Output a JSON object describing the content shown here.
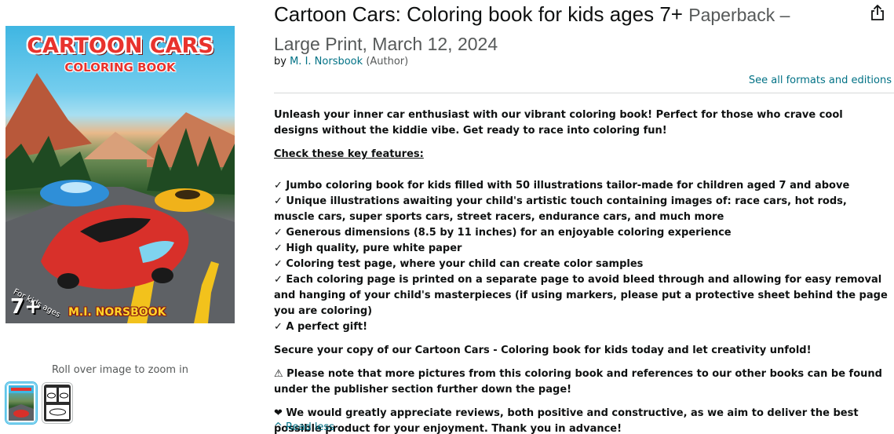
{
  "product": {
    "title": "Cartoon Cars: Coloring book for kids ages 7+",
    "format_date_line1": "Paperback –",
    "format_date_line2": "Large Print, March 12, 2024",
    "by_prefix": "by",
    "author": "M. I. Norsbook",
    "author_role": "(Author)",
    "see_all_formats": "See all formats and editions"
  },
  "cover": {
    "title_line1": "CARTOON CARS",
    "title_line2": "COLORING BOOK",
    "age_big": "7+",
    "age_small": "For kids ages",
    "author_art": "M.I. NORSBOOK"
  },
  "gallery": {
    "zoom_hint": "Roll over image to zoom in",
    "thumbnails": [
      "cover-thumbnail",
      "interior-thumbnail"
    ]
  },
  "description": {
    "intro": "Unleash your inner car enthusiast with our vibrant coloring book! Perfect for those who crave cool designs without the kiddie vibe. Get ready to race into coloring fun!",
    "features_heading": "Check these key features:",
    "features": [
      "✓ Jumbo coloring book for kids filled with 50 illustrations tailor-made for children aged 7 and above",
      "✓ Unique illustrations awaiting your child's artistic touch containing images of: race cars, hot rods, muscle cars, super sports cars, street racers, endurance cars, and much more",
      "✓ Generous dimensions (8.5 by 11 inches) for an enjoyable coloring experience",
      "✓ High quality, pure white paper",
      "✓ Coloring test page, where your child can create color samples",
      "✓ Each coloring page is printed on a separate page to avoid bleed through and allowing for easy removal and hanging of your child's masterpieces (if using markers, please put a protective sheet behind the page you are coloring)",
      "✓ A perfect gift!"
    ],
    "secure_line": "Secure your copy of our Cartoon Cars - Coloring book for kids today and let creativity unfold!",
    "note": "⚠ Please note that more pictures from this coloring book and references to our other books can be found under the publisher section further down the page!",
    "reviews": "❤ We would greatly appreciate reviews, both positive and constructive, as we aim to deliver the best possible product for your enjoyment. Thank you in advance!"
  },
  "read_less": "^ Read less",
  "colors": {
    "link": "#007185",
    "text": "#0f1111",
    "muted": "#565959",
    "cover_sky": "#3fb6e2",
    "cover_title": "#e8332d"
  },
  "icons": {
    "share": "share-icon"
  }
}
